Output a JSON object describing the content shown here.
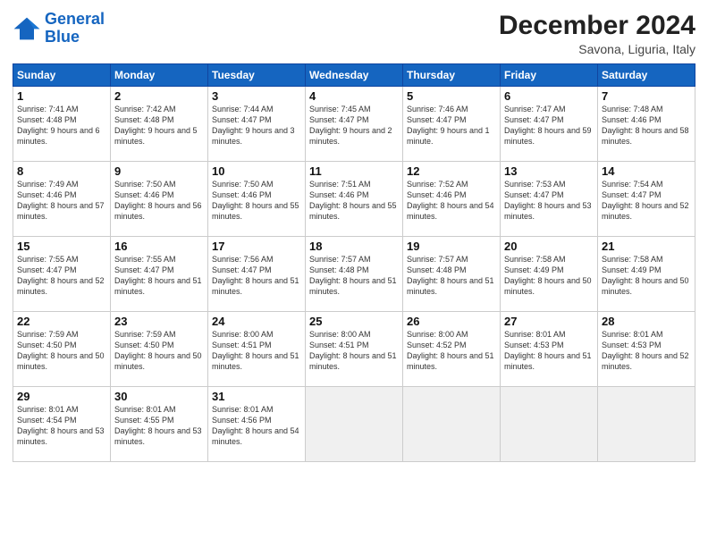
{
  "header": {
    "logo_line1": "General",
    "logo_line2": "Blue",
    "title": "December 2024",
    "location": "Savona, Liguria, Italy"
  },
  "weekdays": [
    "Sunday",
    "Monday",
    "Tuesday",
    "Wednesday",
    "Thursday",
    "Friday",
    "Saturday"
  ],
  "days": [
    {
      "num": "",
      "info": ""
    },
    {
      "num": "",
      "info": ""
    },
    {
      "num": "",
      "info": ""
    },
    {
      "num": "",
      "info": ""
    },
    {
      "num": "",
      "info": ""
    },
    {
      "num": "",
      "info": ""
    },
    {
      "num": "1",
      "info": "Sunrise: 7:41 AM\nSunset: 4:48 PM\nDaylight: 9 hours\nand 6 minutes."
    },
    {
      "num": "2",
      "info": "Sunrise: 7:42 AM\nSunset: 4:48 PM\nDaylight: 9 hours\nand 5 minutes."
    },
    {
      "num": "3",
      "info": "Sunrise: 7:44 AM\nSunset: 4:47 PM\nDaylight: 9 hours\nand 3 minutes."
    },
    {
      "num": "4",
      "info": "Sunrise: 7:45 AM\nSunset: 4:47 PM\nDaylight: 9 hours\nand 2 minutes."
    },
    {
      "num": "5",
      "info": "Sunrise: 7:46 AM\nSunset: 4:47 PM\nDaylight: 9 hours\nand 1 minute."
    },
    {
      "num": "6",
      "info": "Sunrise: 7:47 AM\nSunset: 4:47 PM\nDaylight: 8 hours\nand 59 minutes."
    },
    {
      "num": "7",
      "info": "Sunrise: 7:48 AM\nSunset: 4:46 PM\nDaylight: 8 hours\nand 58 minutes."
    },
    {
      "num": "8",
      "info": "Sunrise: 7:49 AM\nSunset: 4:46 PM\nDaylight: 8 hours\nand 57 minutes."
    },
    {
      "num": "9",
      "info": "Sunrise: 7:50 AM\nSunset: 4:46 PM\nDaylight: 8 hours\nand 56 minutes."
    },
    {
      "num": "10",
      "info": "Sunrise: 7:50 AM\nSunset: 4:46 PM\nDaylight: 8 hours\nand 55 minutes."
    },
    {
      "num": "11",
      "info": "Sunrise: 7:51 AM\nSunset: 4:46 PM\nDaylight: 8 hours\nand 55 minutes."
    },
    {
      "num": "12",
      "info": "Sunrise: 7:52 AM\nSunset: 4:46 PM\nDaylight: 8 hours\nand 54 minutes."
    },
    {
      "num": "13",
      "info": "Sunrise: 7:53 AM\nSunset: 4:47 PM\nDaylight: 8 hours\nand 53 minutes."
    },
    {
      "num": "14",
      "info": "Sunrise: 7:54 AM\nSunset: 4:47 PM\nDaylight: 8 hours\nand 52 minutes."
    },
    {
      "num": "15",
      "info": "Sunrise: 7:55 AM\nSunset: 4:47 PM\nDaylight: 8 hours\nand 52 minutes."
    },
    {
      "num": "16",
      "info": "Sunrise: 7:55 AM\nSunset: 4:47 PM\nDaylight: 8 hours\nand 51 minutes."
    },
    {
      "num": "17",
      "info": "Sunrise: 7:56 AM\nSunset: 4:47 PM\nDaylight: 8 hours\nand 51 minutes."
    },
    {
      "num": "18",
      "info": "Sunrise: 7:57 AM\nSunset: 4:48 PM\nDaylight: 8 hours\nand 51 minutes."
    },
    {
      "num": "19",
      "info": "Sunrise: 7:57 AM\nSunset: 4:48 PM\nDaylight: 8 hours\nand 51 minutes."
    },
    {
      "num": "20",
      "info": "Sunrise: 7:58 AM\nSunset: 4:49 PM\nDaylight: 8 hours\nand 50 minutes."
    },
    {
      "num": "21",
      "info": "Sunrise: 7:58 AM\nSunset: 4:49 PM\nDaylight: 8 hours\nand 50 minutes."
    },
    {
      "num": "22",
      "info": "Sunrise: 7:59 AM\nSunset: 4:50 PM\nDaylight: 8 hours\nand 50 minutes."
    },
    {
      "num": "23",
      "info": "Sunrise: 7:59 AM\nSunset: 4:50 PM\nDaylight: 8 hours\nand 50 minutes."
    },
    {
      "num": "24",
      "info": "Sunrise: 8:00 AM\nSunset: 4:51 PM\nDaylight: 8 hours\nand 51 minutes."
    },
    {
      "num": "25",
      "info": "Sunrise: 8:00 AM\nSunset: 4:51 PM\nDaylight: 8 hours\nand 51 minutes."
    },
    {
      "num": "26",
      "info": "Sunrise: 8:00 AM\nSunset: 4:52 PM\nDaylight: 8 hours\nand 51 minutes."
    },
    {
      "num": "27",
      "info": "Sunrise: 8:01 AM\nSunset: 4:53 PM\nDaylight: 8 hours\nand 51 minutes."
    },
    {
      "num": "28",
      "info": "Sunrise: 8:01 AM\nSunset: 4:53 PM\nDaylight: 8 hours\nand 52 minutes."
    },
    {
      "num": "29",
      "info": "Sunrise: 8:01 AM\nSunset: 4:54 PM\nDaylight: 8 hours\nand 53 minutes."
    },
    {
      "num": "30",
      "info": "Sunrise: 8:01 AM\nSunset: 4:55 PM\nDaylight: 8 hours\nand 53 minutes."
    },
    {
      "num": "31",
      "info": "Sunrise: 8:01 AM\nSunset: 4:56 PM\nDaylight: 8 hours\nand 54 minutes."
    },
    {
      "num": "",
      "info": ""
    },
    {
      "num": "",
      "info": ""
    },
    {
      "num": "",
      "info": ""
    },
    {
      "num": "",
      "info": ""
    },
    {
      "num": "",
      "info": ""
    }
  ]
}
